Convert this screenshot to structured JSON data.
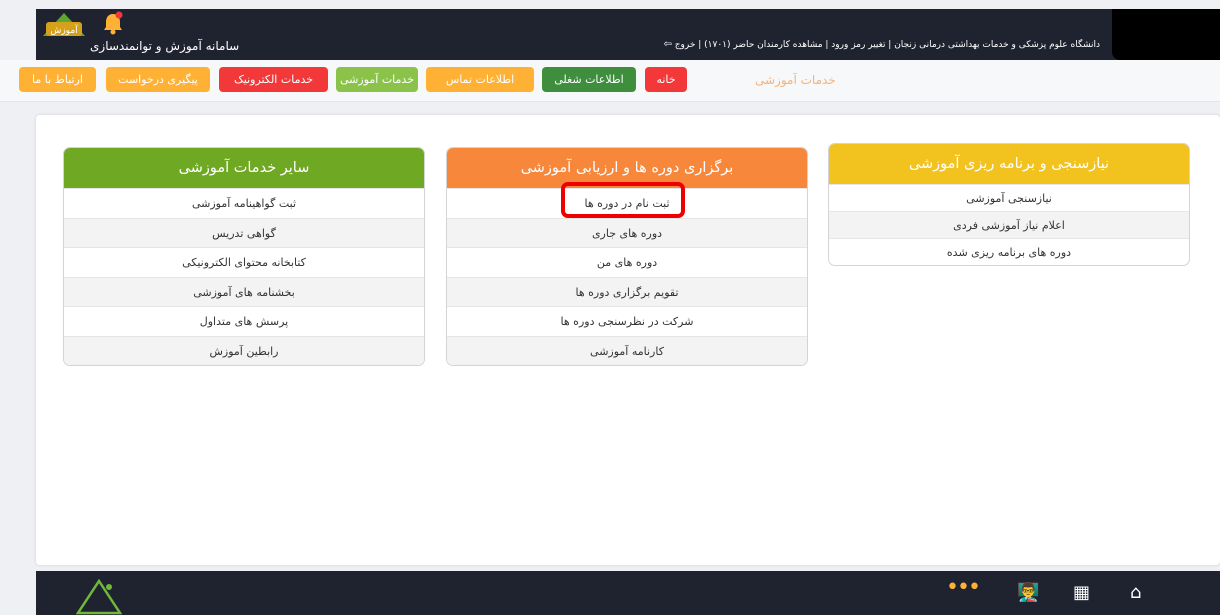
{
  "header": {
    "app_title": "سامانه آموزش و توانمندسازی",
    "logo_text": "آموزش",
    "info_text": "دانشگاه علوم پزشکی و خدمات بهداشتی درمانی زنجان | تغییر رمز ورود | مشاهده کارمندان حاضر (۱۷۰۱) | خروج"
  },
  "nav": {
    "contact_us": "ارتباط با ما",
    "follow_up": "پیگیری درخواست",
    "electronic_services": "خدمات الکترونیک",
    "educational_services": "خدمات آموزشی",
    "contact_info": "اطلاعات تماس",
    "job_info": "اطلاعات شغلی",
    "home": "خانه",
    "current_page": "خدمات آموزشی"
  },
  "panels": {
    "other": {
      "title": "سایر خدمات آموزشی",
      "items": [
        "ثبت گواهینامه آموزشی",
        "گواهی تدریس",
        "کتابخانه محتوای الکترونیکی",
        "بخشنامه های آموزشی",
        "پرسش های متداول",
        "رابطین آموزش"
      ]
    },
    "courses": {
      "title": "برگزاری دوره ها و ارزیابی آموزشی",
      "items": [
        "ثبت نام در دوره ها",
        "دوره های جاری",
        "دوره های من",
        "تقویم برگزاری دوره ها",
        "شرکت در نظرسنجی دوره ها",
        "کارنامه آموزشی"
      ]
    },
    "needs": {
      "title": "نیازسنجی و برنامه ریزی آموزشی",
      "items": [
        "نیازسنجی آموزشی",
        "اعلام نیاز آموزشی فردی",
        "دوره های برنامه ریزی شده"
      ]
    }
  },
  "footer": {
    "more_glyph": "•••",
    "teach_glyph": "👨‍🏫",
    "grid_glyph": "▦",
    "home_glyph": "⌂"
  },
  "colors": {
    "header_bg": "#1f2330",
    "accent_orange": "#ffb135",
    "accent_red": "#f23838",
    "green_light": "#8bc34a",
    "green_dark": "#3e8e3e",
    "panel_green": "#6fa823",
    "panel_orange": "#f7873b",
    "panel_yellow": "#f2c21f",
    "highlight": "#ee0000"
  }
}
